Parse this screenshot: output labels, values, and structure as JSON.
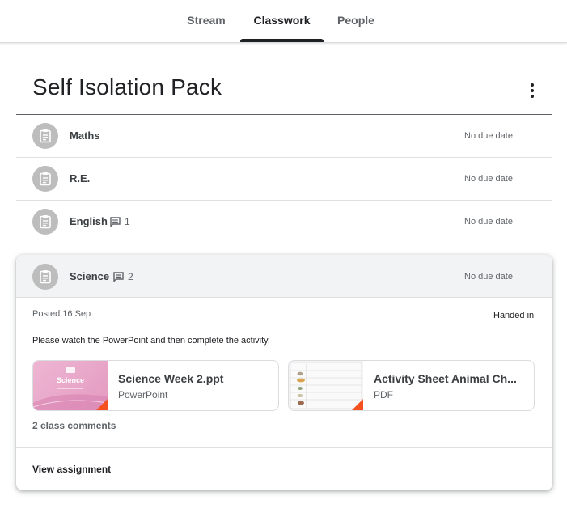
{
  "nav": {
    "tabs": [
      {
        "label": "Stream",
        "active": false
      },
      {
        "label": "Classwork",
        "active": true
      },
      {
        "label": "People",
        "active": false
      }
    ]
  },
  "topic": {
    "title": "Self Isolation Pack",
    "menu_icon": "more-vert-icon"
  },
  "assignments": [
    {
      "title": "Maths",
      "due": "No due date",
      "comments": null,
      "icon": "assignment-icon"
    },
    {
      "title": "R.E.",
      "due": "No due date",
      "comments": null,
      "icon": "assignment-icon"
    },
    {
      "title": "English",
      "due": "No due date",
      "comments": "1",
      "icon": "assignment-icon"
    }
  ],
  "expanded": {
    "title": "Science",
    "comments": "2",
    "due": "No due date",
    "posted": "Posted 16 Sep",
    "status": "Handed in",
    "instructions": "Please watch the PowerPoint and then complete the activity.",
    "attachments": [
      {
        "name": "Science Week 2.ppt",
        "type": "PowerPoint",
        "thumb_title": "Science"
      },
      {
        "name": "Activity Sheet Animal Ch...",
        "type": "PDF"
      }
    ],
    "comments_link": "2 class comments",
    "view_link": "View assignment"
  },
  "colors": {
    "accent_text": "#202124",
    "secondary_text": "#5f6368",
    "icon_circle": "#bdbdbd",
    "file_corner": "#f4511e",
    "ppt_thumb": "#e8a6c8"
  }
}
